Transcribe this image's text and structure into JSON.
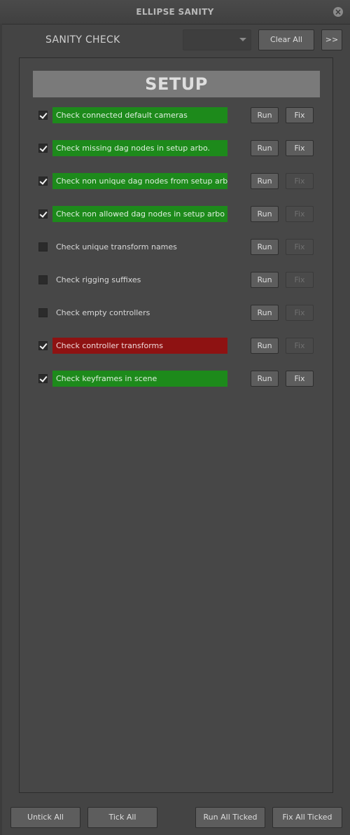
{
  "window": {
    "title": "ELLIPSE SANITY"
  },
  "header": {
    "label": "SANITY CHECK",
    "dropdown_value": "",
    "clear_all_label": "Clear All",
    "more_label": ">>"
  },
  "section": {
    "title": "SETUP"
  },
  "checks": [
    {
      "label": "Check connected default cameras",
      "checked": true,
      "status": "pass",
      "run_label": "Run",
      "fix_label": "Fix",
      "fix_enabled": true
    },
    {
      "label": "Check missing dag nodes in setup arbo.",
      "checked": true,
      "status": "pass",
      "run_label": "Run",
      "fix_label": "Fix",
      "fix_enabled": true
    },
    {
      "label": "Check non unique dag nodes from setup arbo",
      "checked": true,
      "status": "pass",
      "run_label": "Run",
      "fix_label": "Fix",
      "fix_enabled": false
    },
    {
      "label": "Check non allowed dag nodes in setup arbo",
      "checked": true,
      "status": "pass",
      "run_label": "Run",
      "fix_label": "Fix",
      "fix_enabled": false
    },
    {
      "label": "Check unique transform names",
      "checked": false,
      "status": "none",
      "run_label": "Run",
      "fix_label": "Fix",
      "fix_enabled": false
    },
    {
      "label": "Check rigging suffixes",
      "checked": false,
      "status": "none",
      "run_label": "Run",
      "fix_label": "Fix",
      "fix_enabled": false
    },
    {
      "label": "Check empty controllers",
      "checked": false,
      "status": "none",
      "run_label": "Run",
      "fix_label": "Fix",
      "fix_enabled": false
    },
    {
      "label": "Check controller transforms",
      "checked": true,
      "status": "fail",
      "run_label": "Run",
      "fix_label": "Fix",
      "fix_enabled": false
    },
    {
      "label": "Check keyframes in scene",
      "checked": true,
      "status": "pass",
      "run_label": "Run",
      "fix_label": "Fix",
      "fix_enabled": true
    }
  ],
  "footer": {
    "untick_all": "Untick All",
    "tick_all": "Tick All",
    "run_all_ticked": "Run All Ticked",
    "fix_all_ticked": "Fix All Ticked"
  },
  "colors": {
    "pass": "#1d8a1b",
    "fail": "#8e1212",
    "panel": "#474747",
    "section_header": "#7a7a7a"
  }
}
